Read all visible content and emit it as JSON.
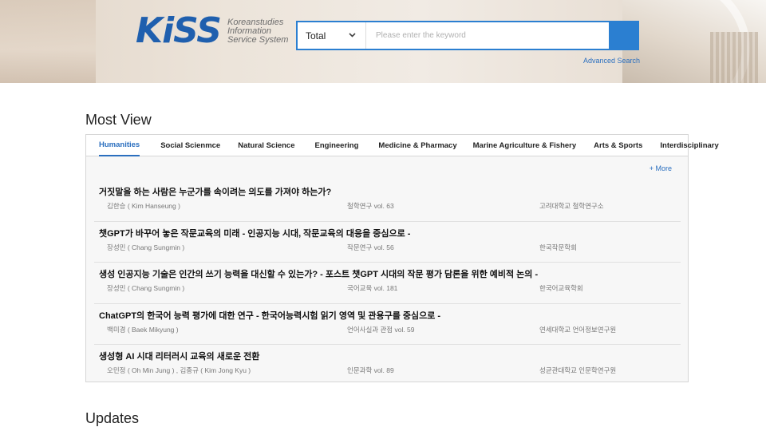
{
  "logo": {
    "mark": "KiSS",
    "line1": "Koreanstudies",
    "line2": "Information",
    "line3": "Service System"
  },
  "search": {
    "category": "Total",
    "placeholder": "Please enter the keyword",
    "value": "",
    "advanced_label": "Advanced Search"
  },
  "most_view": {
    "title": "Most View",
    "more_label": "+ More",
    "tabs": [
      {
        "label": "Humanities",
        "active": true
      },
      {
        "label": "Social Scienmce",
        "active": false
      },
      {
        "label": "Natural Science",
        "active": false
      },
      {
        "label": "Engineering",
        "active": false
      },
      {
        "label": "Medicine & Pharmacy",
        "active": false
      },
      {
        "label": "Marine Agriculture & Fishery",
        "active": false
      },
      {
        "label": "Arts & Sports",
        "active": false
      },
      {
        "label": "Interdisciplinary",
        "active": false
      }
    ],
    "items": [
      {
        "title": "거짓말을 하는 사람은 누군가를 속이려는 의도를 가져야 하는가?",
        "author": "김한승 ( Kim Hanseung )",
        "journal": "철학연구 vol. 63",
        "publisher": "고려대학교 철학연구소"
      },
      {
        "title": "챗GPT가 바꾸어 놓은 작문교육의 미래 - 인공지능 시대, 작문교육의 대응을 중심으로 -",
        "author": "장성민 ( Chang Sungmin )",
        "journal": "작문연구 vol. 56",
        "publisher": "한국작문학회"
      },
      {
        "title": "생성 인공지능 기술은 인간의 쓰기 능력을 대신할 수 있는가? - 포스트 챗GPT 시대의 작문 평가 담론을 위한 예비적 논의 -",
        "author": "장성민 ( Chang Sungmin )",
        "journal": "국어교육 vol. 181",
        "publisher": "한국어교육학회"
      },
      {
        "title": "ChatGPT의 한국어 능력 평가에 대한 연구 - 한국어능력시험 읽기 영역 및 관용구를 중심으로 -",
        "author": "백미경 ( Baek Mikyung )",
        "journal": "언어사실과 관점 vol. 59",
        "publisher": "연세대학교 언어정보연구원"
      },
      {
        "title": "생성형 AI 시대 리터러시 교육의 새로운 전환",
        "author": "오민정 ( Oh Min Jung ) , 김종규 ( Kim Jong Kyu )",
        "journal": "인문과학 vol. 89",
        "publisher": "성균관대학교 인문학연구원"
      }
    ]
  },
  "updates": {
    "title": "Updates"
  },
  "colors": {
    "accent": "#2b7fd1",
    "link": "#2b6fbf",
    "logo": "#1f5fae"
  }
}
